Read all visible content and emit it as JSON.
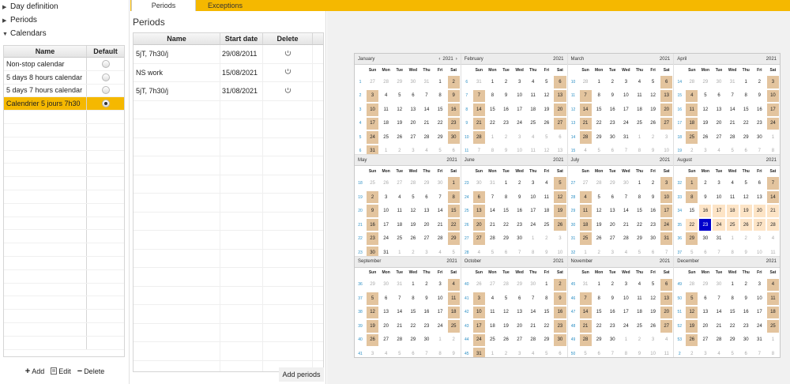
{
  "tree": [
    {
      "label": "Day definition",
      "arrow": "▶"
    },
    {
      "label": "Periods",
      "arrow": "▶"
    },
    {
      "label": "Calendars",
      "arrow": "▼"
    }
  ],
  "calendars": {
    "headers": {
      "name": "Name",
      "default": "Default"
    },
    "rows": [
      {
        "name": "Non-stop calendar",
        "default": false,
        "selected": false
      },
      {
        "name": "5 days 8 hours calendar",
        "default": false,
        "selected": false
      },
      {
        "name": "5 days 7 hours calendar",
        "default": false,
        "selected": false
      },
      {
        "name": "Calendrier 5 jours 7h30",
        "default": true,
        "selected": true
      }
    ],
    "empty_rows": 18
  },
  "bottom": {
    "add": "Add",
    "edit": "Edit",
    "delete": "Delete"
  },
  "tabs": {
    "periods": "Periods",
    "exceptions": "Exceptions"
  },
  "periods": {
    "title": "Periods",
    "headers": {
      "name": "Name",
      "start": "Start date",
      "delete": "Delete"
    },
    "rows": [
      {
        "name": "5jT, 7h30/j",
        "start": "29/08/2011"
      },
      {
        "name": "NS work",
        "start": "15/08/2021"
      },
      {
        "name": "5jT, 7h30/j",
        "start": "31/08/2021"
      }
    ],
    "empty_rows": 15,
    "add_button": "Add periods"
  },
  "year": "2021",
  "weekdays": [
    "Sun",
    "Mon",
    "Tue",
    "Wed",
    "Thu",
    "Fri",
    "Sat"
  ],
  "months": [
    {
      "name": "January",
      "nav": true,
      "weeks": [
        "1",
        "2",
        "3",
        "4",
        "5",
        "6"
      ],
      "days": [
        [
          "27",
          "28",
          "29",
          "30",
          "31",
          "1",
          "2"
        ],
        [
          "3",
          "4",
          "5",
          "6",
          "7",
          "8",
          "9"
        ],
        [
          "10",
          "11",
          "12",
          "13",
          "14",
          "15",
          "16"
        ],
        [
          "17",
          "18",
          "19",
          "20",
          "21",
          "22",
          "23"
        ],
        [
          "24",
          "25",
          "26",
          "27",
          "28",
          "29",
          "30"
        ],
        [
          "31",
          "1",
          "2",
          "3",
          "4",
          "5",
          "6"
        ]
      ]
    },
    {
      "name": "February",
      "weeks": [
        "6",
        "7",
        "8",
        "9",
        "10",
        "11"
      ],
      "days": [
        [
          "31",
          "1",
          "2",
          "3",
          "4",
          "5",
          "6"
        ],
        [
          "7",
          "8",
          "9",
          "10",
          "11",
          "12",
          "13"
        ],
        [
          "14",
          "15",
          "16",
          "17",
          "18",
          "19",
          "20"
        ],
        [
          "21",
          "22",
          "23",
          "24",
          "25",
          "26",
          "27"
        ],
        [
          "28",
          "1",
          "2",
          "3",
          "4",
          "5",
          "6"
        ],
        [
          "7",
          "8",
          "9",
          "10",
          "11",
          "12",
          "13"
        ]
      ]
    },
    {
      "name": "March",
      "weeks": [
        "10",
        "11",
        "12",
        "13",
        "14",
        "15"
      ],
      "days": [
        [
          "28",
          "1",
          "2",
          "3",
          "4",
          "5",
          "6"
        ],
        [
          "7",
          "8",
          "9",
          "10",
          "11",
          "12",
          "13"
        ],
        [
          "14",
          "15",
          "16",
          "17",
          "18",
          "19",
          "20"
        ],
        [
          "21",
          "22",
          "23",
          "24",
          "25",
          "26",
          "27"
        ],
        [
          "28",
          "29",
          "30",
          "31",
          "1",
          "2",
          "3"
        ],
        [
          "4",
          "5",
          "6",
          "7",
          "8",
          "9",
          "10"
        ]
      ]
    },
    {
      "name": "April",
      "weeks": [
        "14",
        "15",
        "16",
        "17",
        "18",
        "19"
      ],
      "days": [
        [
          "28",
          "29",
          "30",
          "31",
          "1",
          "2",
          "3"
        ],
        [
          "4",
          "5",
          "6",
          "7",
          "8",
          "9",
          "10"
        ],
        [
          "11",
          "12",
          "13",
          "14",
          "15",
          "16",
          "17"
        ],
        [
          "18",
          "19",
          "20",
          "21",
          "22",
          "23",
          "24"
        ],
        [
          "25",
          "26",
          "27",
          "28",
          "29",
          "30",
          "1"
        ],
        [
          "2",
          "3",
          "4",
          "5",
          "6",
          "7",
          "8"
        ]
      ]
    },
    {
      "name": "May",
      "weeks": [
        "18",
        "19",
        "20",
        "21",
        "22",
        "23"
      ],
      "days": [
        [
          "25",
          "26",
          "27",
          "28",
          "29",
          "30",
          "1"
        ],
        [
          "2",
          "3",
          "4",
          "5",
          "6",
          "7",
          "8"
        ],
        [
          "9",
          "10",
          "11",
          "12",
          "13",
          "14",
          "15"
        ],
        [
          "16",
          "17",
          "18",
          "19",
          "20",
          "21",
          "22"
        ],
        [
          "23",
          "24",
          "25",
          "26",
          "27",
          "28",
          "29"
        ],
        [
          "30",
          "31",
          "1",
          "2",
          "3",
          "4",
          "5"
        ]
      ]
    },
    {
      "name": "June",
      "weeks": [
        "23",
        "24",
        "25",
        "26",
        "27",
        "28"
      ],
      "days": [
        [
          "30",
          "31",
          "1",
          "2",
          "3",
          "4",
          "5"
        ],
        [
          "6",
          "7",
          "8",
          "9",
          "10",
          "11",
          "12"
        ],
        [
          "13",
          "14",
          "15",
          "16",
          "17",
          "18",
          "19"
        ],
        [
          "20",
          "21",
          "22",
          "23",
          "24",
          "25",
          "26"
        ],
        [
          "27",
          "28",
          "29",
          "30",
          "1",
          "2",
          "3"
        ],
        [
          "4",
          "5",
          "6",
          "7",
          "8",
          "9",
          "10"
        ]
      ]
    },
    {
      "name": "July",
      "weeks": [
        "27",
        "28",
        "29",
        "30",
        "31",
        "32"
      ],
      "days": [
        [
          "27",
          "28",
          "29",
          "30",
          "1",
          "2",
          "3"
        ],
        [
          "4",
          "5",
          "6",
          "7",
          "8",
          "9",
          "10"
        ],
        [
          "11",
          "12",
          "13",
          "14",
          "15",
          "16",
          "17"
        ],
        [
          "18",
          "19",
          "20",
          "21",
          "22",
          "23",
          "24"
        ],
        [
          "25",
          "26",
          "27",
          "28",
          "29",
          "30",
          "31"
        ],
        [
          "1",
          "2",
          "3",
          "4",
          "5",
          "6",
          "7"
        ]
      ]
    },
    {
      "name": "August",
      "aug": true,
      "weeks": [
        "32",
        "33",
        "34",
        "35",
        "36",
        "37"
      ],
      "days": [
        [
          "1",
          "2",
          "3",
          "4",
          "5",
          "6",
          "7"
        ],
        [
          "8",
          "9",
          "10",
          "11",
          "12",
          "13",
          "14"
        ],
        [
          "15",
          "16",
          "17",
          "18",
          "19",
          "20",
          "21"
        ],
        [
          "22",
          "23",
          "24",
          "25",
          "26",
          "27",
          "28"
        ],
        [
          "29",
          "30",
          "31",
          "1",
          "2",
          "3",
          "4"
        ],
        [
          "5",
          "6",
          "7",
          "8",
          "9",
          "10",
          "11"
        ]
      ]
    },
    {
      "name": "September",
      "weeks": [
        "36",
        "37",
        "38",
        "39",
        "40",
        "41"
      ],
      "days": [
        [
          "29",
          "30",
          "31",
          "1",
          "2",
          "3",
          "4"
        ],
        [
          "5",
          "6",
          "7",
          "8",
          "9",
          "10",
          "11"
        ],
        [
          "12",
          "13",
          "14",
          "15",
          "16",
          "17",
          "18"
        ],
        [
          "19",
          "20",
          "21",
          "22",
          "23",
          "24",
          "25"
        ],
        [
          "26",
          "27",
          "28",
          "29",
          "30",
          "1",
          "2"
        ],
        [
          "3",
          "4",
          "5",
          "6",
          "7",
          "8",
          "9"
        ]
      ]
    },
    {
      "name": "October",
      "weeks": [
        "40",
        "41",
        "42",
        "43",
        "44",
        "45"
      ],
      "days": [
        [
          "26",
          "27",
          "28",
          "29",
          "30",
          "1",
          "2"
        ],
        [
          "3",
          "4",
          "5",
          "6",
          "7",
          "8",
          "9"
        ],
        [
          "10",
          "11",
          "12",
          "13",
          "14",
          "15",
          "16"
        ],
        [
          "17",
          "18",
          "19",
          "20",
          "21",
          "22",
          "23"
        ],
        [
          "24",
          "25",
          "26",
          "27",
          "28",
          "29",
          "30"
        ],
        [
          "31",
          "1",
          "2",
          "3",
          "4",
          "5",
          "6"
        ]
      ]
    },
    {
      "name": "November",
      "weeks": [
        "45",
        "46",
        "47",
        "48",
        "49",
        "50"
      ],
      "days": [
        [
          "31",
          "1",
          "2",
          "3",
          "4",
          "5",
          "6"
        ],
        [
          "7",
          "8",
          "9",
          "10",
          "11",
          "12",
          "13"
        ],
        [
          "14",
          "15",
          "16",
          "17",
          "18",
          "19",
          "20"
        ],
        [
          "21",
          "22",
          "23",
          "24",
          "25",
          "26",
          "27"
        ],
        [
          "28",
          "29",
          "30",
          "1",
          "2",
          "3",
          "4"
        ],
        [
          "5",
          "6",
          "7",
          "8",
          "9",
          "10",
          "11"
        ]
      ]
    },
    {
      "name": "December",
      "weeks": [
        "49",
        "50",
        "51",
        "52",
        "53",
        "2"
      ],
      "days": [
        [
          "28",
          "29",
          "30",
          "1",
          "2",
          "3",
          "4"
        ],
        [
          "5",
          "6",
          "7",
          "8",
          "9",
          "10",
          "11"
        ],
        [
          "12",
          "13",
          "14",
          "15",
          "16",
          "17",
          "18"
        ],
        [
          "19",
          "20",
          "21",
          "22",
          "23",
          "24",
          "25"
        ],
        [
          "26",
          "27",
          "28",
          "29",
          "30",
          "31",
          "1"
        ],
        [
          "2",
          "3",
          "4",
          "5",
          "6",
          "7",
          "8"
        ]
      ]
    }
  ],
  "today": {
    "month": "August",
    "day": "23"
  },
  "colors": {
    "accent": "#f5b800",
    "off_day": "#e3c49e",
    "august_week": "#fde4c6",
    "today": "#0000cc",
    "week_number": "#2b8fc4"
  }
}
